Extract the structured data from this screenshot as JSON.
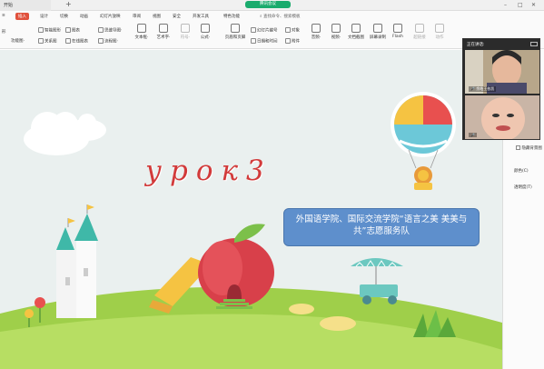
{
  "titlebar": {
    "tab_label": "开始",
    "meeting_label": "腾讯会议"
  },
  "menu": {
    "items": [
      "插入",
      "设计",
      "切换",
      "动画",
      "幻灯片放映",
      "审阅",
      "视图",
      "安全",
      "开发工具",
      "特色功能"
    ],
    "active": "插入",
    "search_label": "查找命令、搜索模板"
  },
  "ribbon": {
    "items": [
      {
        "label": "功能图·"
      },
      {
        "label": "智能图形"
      },
      {
        "label": "关系图"
      },
      {
        "label": "图表"
      },
      {
        "label": "在线图表"
      },
      {
        "label": "思维导图·"
      },
      {
        "label": "流程图·"
      },
      {
        "label": "文本框·"
      },
      {
        "label": "艺术字·"
      },
      {
        "label": "符号·"
      },
      {
        "label": "公式·"
      },
      {
        "label": "页眉和页脚"
      },
      {
        "label": "幻灯片编号"
      },
      {
        "label": "对象"
      },
      {
        "label": "日期和时间"
      },
      {
        "label": "附件"
      },
      {
        "label": "音频·"
      },
      {
        "label": "视频·"
      },
      {
        "label": "文档截图"
      },
      {
        "label": "屏幕录制"
      },
      {
        "label": "Flash"
      },
      {
        "label": "超链接"
      },
      {
        "label": "动作"
      }
    ],
    "left_label": "形"
  },
  "video": {
    "header": "正在讲话:",
    "participant_name": "余皓王依凯"
  },
  "right_panel": {
    "checkbox_label": "隐藏背景图",
    "color_label": "颜色(C)",
    "transparency_label": "透明度(T)"
  },
  "slide": {
    "title": "урок3",
    "callout": "外国语学院、国际交流学院“语言之美 美美与共”志愿服务队"
  },
  "colors": {
    "accent_red": "#e0513c",
    "meeting_green": "#1aab6d",
    "callout_blue": "#5e8fcc",
    "title_red": "#d23a3a"
  }
}
